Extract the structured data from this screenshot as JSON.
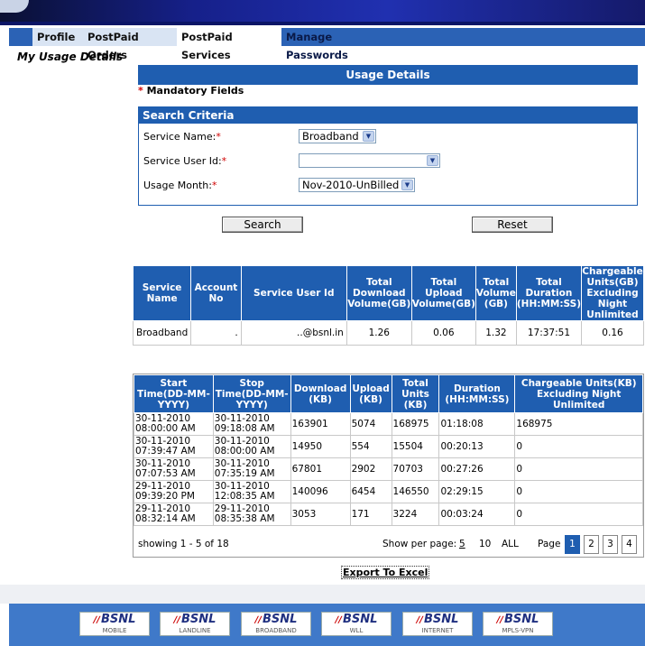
{
  "nav": {
    "tabs": [
      {
        "label": "Profile"
      },
      {
        "label": "PostPaid Orders"
      },
      {
        "label": "PostPaid Services"
      },
      {
        "label": "Manage Passwords"
      }
    ]
  },
  "page_title": "My Usage Details",
  "usage_header": "Usage Details",
  "mandatory": {
    "star": "*",
    "label": "Mandatory Fields"
  },
  "criteria": {
    "title": "Search Criteria",
    "service_name": {
      "label": "Service Name:",
      "value": "Broadband"
    },
    "service_user_id": {
      "label": "Service User Id:",
      "value": ""
    },
    "usage_month": {
      "label": "Usage Month:",
      "value": "Nov-2010-UnBilled"
    },
    "required_mark": "*"
  },
  "buttons": {
    "search": "Search",
    "reset": "Reset"
  },
  "summary": {
    "headers": [
      "Service Name",
      "Account No",
      "Service User Id",
      "Total Download Volume(GB)",
      "Total Upload Volume(GB)",
      "Total Volume (GB)",
      "Total Duration (HH:MM:SS)",
      "Chargeable Units(GB) Excluding Night Unlimited"
    ],
    "row": [
      "Broadband",
      ".",
      "..@bsnl.in",
      "1.26",
      "0.06",
      "1.32",
      "17:37:51",
      "0.16"
    ]
  },
  "detail": {
    "headers": [
      "Start Time(DD-MM-YYYY)",
      "Stop Time(DD-MM-YYYY)",
      "Download (KB)",
      "Upload (KB)",
      "Total Units (KB)",
      "Duration (HH:MM:SS)",
      "Chargeable Units(KB) Excluding Night Unlimited"
    ],
    "rows": [
      [
        "30-11-2010 08:00:00 AM",
        "30-11-2010 09:18:08 AM",
        "163901",
        "5074",
        "168975",
        "01:18:08",
        "168975"
      ],
      [
        "30-11-2010 07:39:47 AM",
        "30-11-2010 08:00:00 AM",
        "14950",
        "554",
        "15504",
        "00:20:13",
        "0"
      ],
      [
        "30-11-2010 07:07:53 AM",
        "30-11-2010 07:35:19 AM",
        "67801",
        "2902",
        "70703",
        "00:27:26",
        "0"
      ],
      [
        "29-11-2010 09:39:20 PM",
        "30-11-2010 12:08:35 AM",
        "140096",
        "6454",
        "146550",
        "02:29:15",
        "0"
      ],
      [
        "29-11-2010 08:32:14 AM",
        "29-11-2010 08:35:38 AM",
        "3053",
        "171",
        "3224",
        "00:03:24",
        "0"
      ]
    ]
  },
  "pager": {
    "showing": "showing 1 - 5 of 18",
    "per_page_label": "Show per page:",
    "per_page_options": [
      "5",
      "10",
      "ALL"
    ],
    "page_label": "Page",
    "pages": [
      "1",
      "2",
      "3",
      "4"
    ],
    "current_page": "1"
  },
  "export_label": "Export To Excel",
  "footer_logos": [
    {
      "brand": "BSNL",
      "sub": "MOBILE"
    },
    {
      "brand": "BSNL",
      "sub": "LANDLINE"
    },
    {
      "brand": "BSNL",
      "sub": "BROADBAND"
    },
    {
      "brand": "BSNL",
      "sub": "WLL"
    },
    {
      "brand": "BSNL",
      "sub": "INTERNET"
    },
    {
      "brand": "BSNL",
      "sub": "MPLS-VPN"
    }
  ]
}
